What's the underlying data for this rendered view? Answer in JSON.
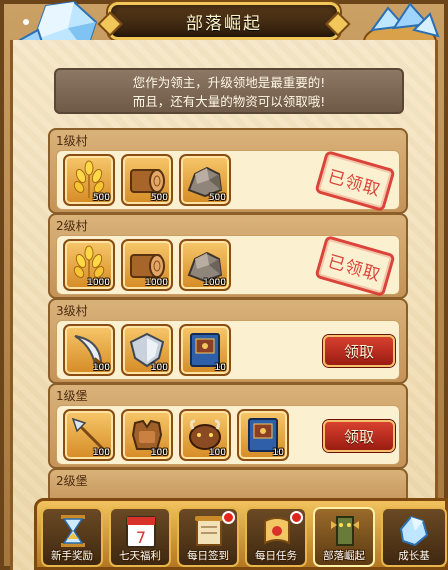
{
  "title": "部落崛起",
  "info": {
    "line1": "您作为领主，升级领地是最重要的!",
    "line2": "而且，还有大量的物资可以领取哦!"
  },
  "tiers": [
    {
      "label": "1级村",
      "status": "claimed",
      "stamp": "已领取",
      "rewards": [
        {
          "icon": "wheat-icon",
          "qty": "500"
        },
        {
          "icon": "wood-log-icon",
          "qty": "500"
        },
        {
          "icon": "stone-icon",
          "qty": "500"
        }
      ]
    },
    {
      "label": "2级村",
      "status": "claimed",
      "stamp": "已领取",
      "rewards": [
        {
          "icon": "wheat-icon",
          "qty": "1000"
        },
        {
          "icon": "wood-log-icon",
          "qty": "1000"
        },
        {
          "icon": "stone-icon",
          "qty": "1000"
        }
      ]
    },
    {
      "label": "3级村",
      "status": "available",
      "button": "领取",
      "rewards": [
        {
          "icon": "scimitar-icon",
          "qty": "100"
        },
        {
          "icon": "shield-icon",
          "qty": "100"
        },
        {
          "icon": "spellbook-icon",
          "qty": "10"
        }
      ]
    },
    {
      "label": "1级堡",
      "status": "available",
      "button": "领取",
      "rewards": [
        {
          "icon": "spear-icon",
          "qty": "100"
        },
        {
          "icon": "armor-icon",
          "qty": "100"
        },
        {
          "icon": "beast-icon",
          "qty": "100"
        },
        {
          "icon": "spellbook-icon",
          "qty": "10"
        }
      ]
    },
    {
      "label": "2级堡",
      "status": "partial",
      "rewards": []
    }
  ],
  "nav": [
    {
      "label": "新手奖励",
      "icon": "hourglass-icon",
      "badge": false,
      "active": false
    },
    {
      "label": "七天福利",
      "icon": "calendar-icon",
      "badge": false,
      "active": false,
      "calendar_day": "7"
    },
    {
      "label": "每日签到",
      "icon": "scroll-icon",
      "badge": true,
      "active": false
    },
    {
      "label": "每日任务",
      "icon": "quest-scroll-icon",
      "badge": true,
      "active": false
    },
    {
      "label": "部落崛起",
      "icon": "tribe-totem-icon",
      "badge": false,
      "active": true
    },
    {
      "label": "成长基",
      "icon": "crystal-icon",
      "badge": false,
      "active": false
    }
  ],
  "colors": {
    "accent_gold": "#f1c75a",
    "claim_red": "#c22b1e",
    "stamp_red": "#d8322a",
    "panel_cream": "#f6e7c7"
  }
}
